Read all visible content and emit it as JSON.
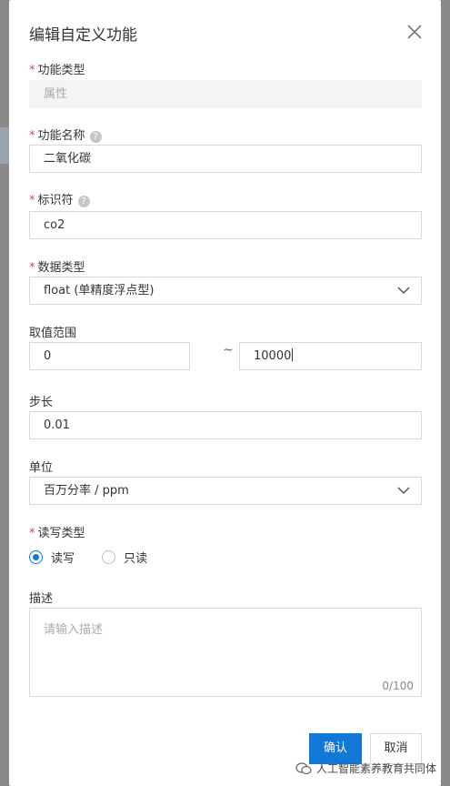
{
  "dialog": {
    "title": "编辑自定义功能"
  },
  "form": {
    "function_type": {
      "label": "功能类型",
      "value": "属性"
    },
    "function_name": {
      "label": "功能名称",
      "value": "二氧化碳"
    },
    "identifier": {
      "label": "标识符",
      "value": "co2"
    },
    "data_type": {
      "label": "数据类型",
      "value": "float (单精度浮点型)"
    },
    "value_range": {
      "label": "取值范围",
      "min": "0",
      "separator": "~",
      "max": "10000"
    },
    "step": {
      "label": "步长",
      "value": "0.01"
    },
    "unit": {
      "label": "单位",
      "value": "百万分率 / ppm"
    },
    "rw_type": {
      "label": "读写类型",
      "options": [
        {
          "label": "读写",
          "checked": true
        },
        {
          "label": "只读",
          "checked": false
        }
      ]
    },
    "description": {
      "label": "描述",
      "placeholder": "请输入描述",
      "counter": "0/100"
    },
    "required_mark": "*",
    "help_mark": "?"
  },
  "buttons": {
    "confirm": "确认",
    "cancel": "取消"
  },
  "watermark": {
    "text": "人工智能素养教育共同体"
  },
  "colors": {
    "primary": "#1377d6",
    "required": "#e54545",
    "overlay": "#8a8a8a"
  }
}
